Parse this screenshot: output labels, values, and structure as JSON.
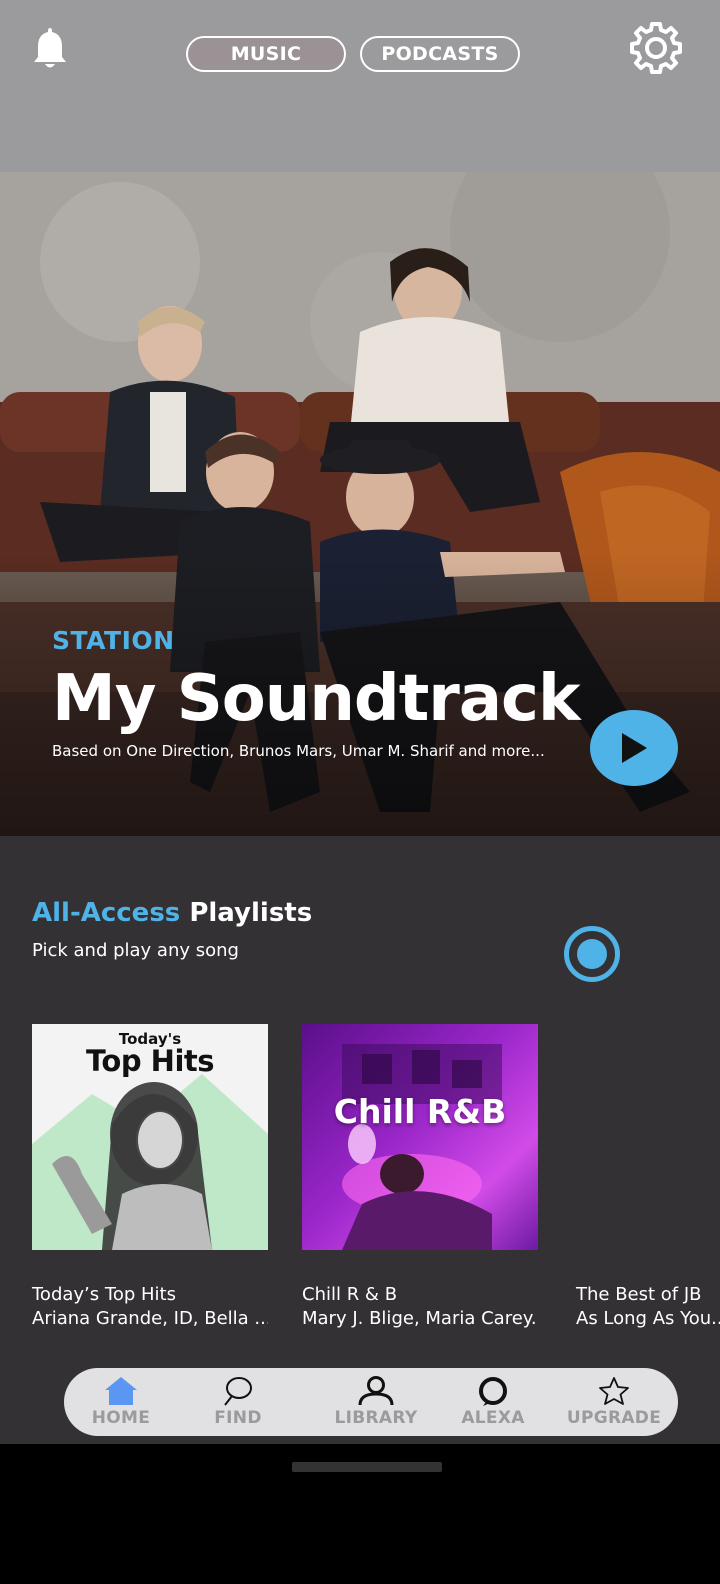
{
  "header": {
    "tabs": [
      {
        "label": "MUSIC",
        "selected": true
      },
      {
        "label": "PODCASTS",
        "selected": false
      }
    ],
    "icons": {
      "left": "bell-icon",
      "right": "gear-icon"
    }
  },
  "hero": {
    "kicker": "STATION",
    "title": "My Soundtrack",
    "subtitle": "Based on One Direction, Brunos Mars, Umar M. Sharif and more...",
    "accent_color": "#4fb3e8"
  },
  "section": {
    "title_accent": "All-Access",
    "title_rest": "Playlists",
    "subtitle": "Pick and play any song"
  },
  "playlists": [
    {
      "art_small": "Today's",
      "art_big": "Top Hits",
      "name": "Today’s Top Hits",
      "desc": "Ariana Grande, ID, Bella ..."
    },
    {
      "art_big": "Chill R&B",
      "name": "Chill R & B",
      "desc": "Mary J. Blige, Maria Carey..."
    },
    {
      "name": "The Best of JB",
      "desc": "As Long As You..."
    }
  ],
  "nav": [
    {
      "label": "HOME",
      "icon": "home-icon",
      "active": true
    },
    {
      "label": "FIND",
      "icon": "search-icon",
      "active": false
    },
    {
      "label": "LIBRARY",
      "icon": "user-icon",
      "active": false
    },
    {
      "label": "ALEXA",
      "icon": "alexa-icon",
      "active": false
    },
    {
      "label": "UPGRADE",
      "icon": "star-icon",
      "active": false
    }
  ]
}
